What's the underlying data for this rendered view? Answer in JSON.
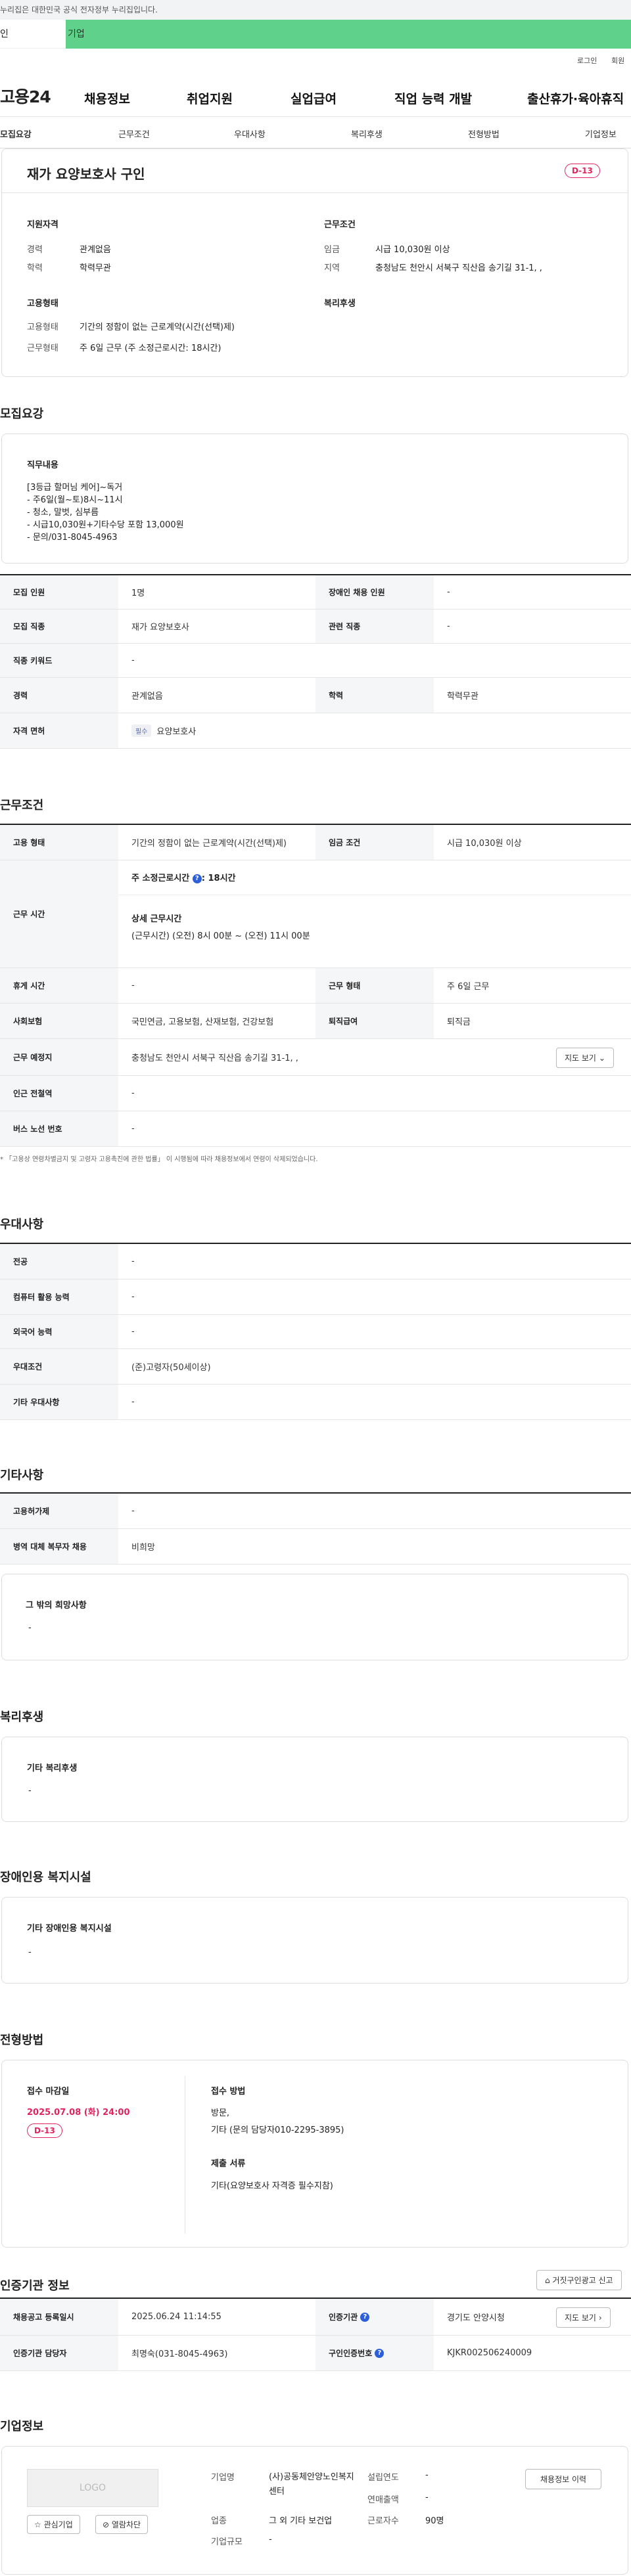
{
  "gov_notice": "누리집은 대한민국 공식 전자정부 누리집입니다.",
  "member_tabs": {
    "individual": "인",
    "corporate": "기업"
  },
  "util_links": {
    "login": "로그인",
    "signup": "회원"
  },
  "header": {
    "logo": "고용24",
    "menus": [
      "채용정보",
      "취업지원",
      "실업급여",
      "직업 능력 개발",
      "출산휴가·육아휴직"
    ]
  },
  "lnb": [
    "모집요강",
    "근무조건",
    "우대사항",
    "복리후생",
    "전형방법",
    "기업정보"
  ],
  "job": {
    "title": "재가 요양보호사 구인",
    "dday": "D-13",
    "qualification_title": "지원자격",
    "career_label": "경력",
    "career_value": "관계없음",
    "education_label": "학력",
    "education_value": "학력무관",
    "employment_title": "고용형태",
    "emp_type_label": "고용형태",
    "emp_type_value": "기간의 정함이 없는 근로계약(시간(선택)제)",
    "work_type_label": "근무형태",
    "work_type_value": "주 6일 근무 (주 소정근로시간: 18시간)",
    "conditions_title": "근무조건",
    "wage_label": "임금",
    "wage_value": "시급 10,030원 이상",
    "region_label": "지역",
    "region_value": "충청남도 천안시 서북구 직산읍 송기길 31-1, ,",
    "welfare_title": "복리후생"
  },
  "recruit": {
    "section_title": "모집요강",
    "duty_title": "직무내용",
    "duty_lines": [
      "[3등급 할머님 케어]~독거",
      "- 주6일(월~토)8시~11시",
      "- 청소, 말벗, 심부름",
      "- 시급10,030원+기타수당 포함 13,000원",
      "- 문의/031-8045-4963"
    ],
    "rows": [
      {
        "th1": "모집 인원",
        "td1": "1명",
        "th2": "장애인 채용 인원",
        "td2": "-"
      },
      {
        "th1": "모집 직종",
        "td1": "재가 요양보호사",
        "th2": "관련 직종",
        "td2": "-"
      },
      {
        "th1": "직종 키워드",
        "td1": "-"
      },
      {
        "th1": "경력",
        "td1": "관계없음",
        "th2": "학력",
        "td2": "학력무관"
      },
      {
        "th1": "자격 면허",
        "pill": "필수",
        "td1": "요양보호사"
      }
    ]
  },
  "work": {
    "section_title": "근무조건",
    "emp_type_th": "고용 형태",
    "emp_type_td": "기간의 정함이 없는 근로계약(시간(선택)제)",
    "wage_th": "임금 조건",
    "wage_td": "시급 10,030원 이상",
    "hours_th": "근무 시간",
    "hours_weekly": "주 소정근로시간 ",
    "hours_weekly_value": ": 18시간",
    "hours_detail_title": "상세 근무시간",
    "hours_detail": "(근무시간) (오전) 8시 00분 ~ (오전) 11시 00분",
    "break_th": "휴게 시간",
    "break_td": "-",
    "shape_th": "근무 형태",
    "shape_td": "주 6일 근무",
    "insurance_th": "사회보험",
    "insurance_td": "국민연금, 고용보험, 산재보험, 건강보험",
    "severance_th": "퇴직급여",
    "severance_td": "퇴직금",
    "place_th": "근무 예정지",
    "place_td": "충청남도 천안시 서북구 직산읍 송기길 31-1, ,",
    "map_button": "지도 보기",
    "subway_th": "인근 전철역",
    "subway_td": "-",
    "bus_th": "버스 노선 번호",
    "bus_td": "-",
    "notice": "「고용상 연령차별금지 및 고령자 고용촉진에 관한 법률」 이 시행됨에 따라 채용정보에서 연령이 삭제되었습니다."
  },
  "preference": {
    "section_title": "우대사항",
    "rows": [
      {
        "th": "전공",
        "td": "-"
      },
      {
        "th": "컴퓨터 활용 능력",
        "td": "-"
      },
      {
        "th": "외국어 능력",
        "td": "-"
      },
      {
        "th": "우대조건",
        "td": "(준)고령자(50세이상)"
      },
      {
        "th": "기타 우대사항",
        "td": "-"
      }
    ]
  },
  "etc": {
    "section_title": "기타사항",
    "rows": [
      {
        "th": "고용허가제",
        "td": "-"
      },
      {
        "th": "병역 대체 복무자 채용",
        "td": "비희망"
      }
    ],
    "other_title": "그 밖의 희망사항",
    "other_value": "-"
  },
  "welfare": {
    "section_title": "복리후생",
    "box_title": "기타 복리후생",
    "box_value": "-"
  },
  "disabled": {
    "section_title": "장애인용 복지시설",
    "box_title": "기타 장애인용 복지시설",
    "box_value": "-"
  },
  "selection": {
    "section_title": "전형방법",
    "deadline_title": "접수 마감일",
    "deadline_value": "2025.07.08 (화) 24:00",
    "dday": "D-13",
    "method_title": "접수 방법",
    "method_lines": [
      "방문,",
      "기타 (문의 담당자010-2295-3895)"
    ],
    "docs_title": "제출 서류",
    "docs_value": "기타(요양보호사 자격증 필수지참)"
  },
  "agency": {
    "section_title": "인증기관 정보",
    "report_button": "거짓구인광고 신고",
    "reg_date_th": "채용공고 등록일시",
    "reg_date_td": "2025.06.24 11:14:55",
    "agency_th": "인증기관",
    "agency_td": "경기도 안양시청",
    "map_button": "지도 보기",
    "manager_th": "인증기관 담당자",
    "manager_td": "최명숙(031-8045-4963)",
    "cert_th": "구인인증번호",
    "cert_td": "KJKR002506240009"
  },
  "company": {
    "section_title": "기업정보",
    "logo_text": "LOGO",
    "interest_button": "관심기업",
    "block_button": "열람차단",
    "name_label": "기업명",
    "name_value": "(사)공동체안양노인복지센터",
    "industry_label": "업종",
    "industry_value": "그 외 기타 보건업",
    "size_label": "기업규모",
    "size_value": "-",
    "founded_label": "설립연도",
    "founded_value": "-",
    "sales_label": "연매출액",
    "sales_value": "-",
    "employees_label": "근로자수",
    "employees_value": "90명",
    "history_button": "채용정보 이력"
  }
}
